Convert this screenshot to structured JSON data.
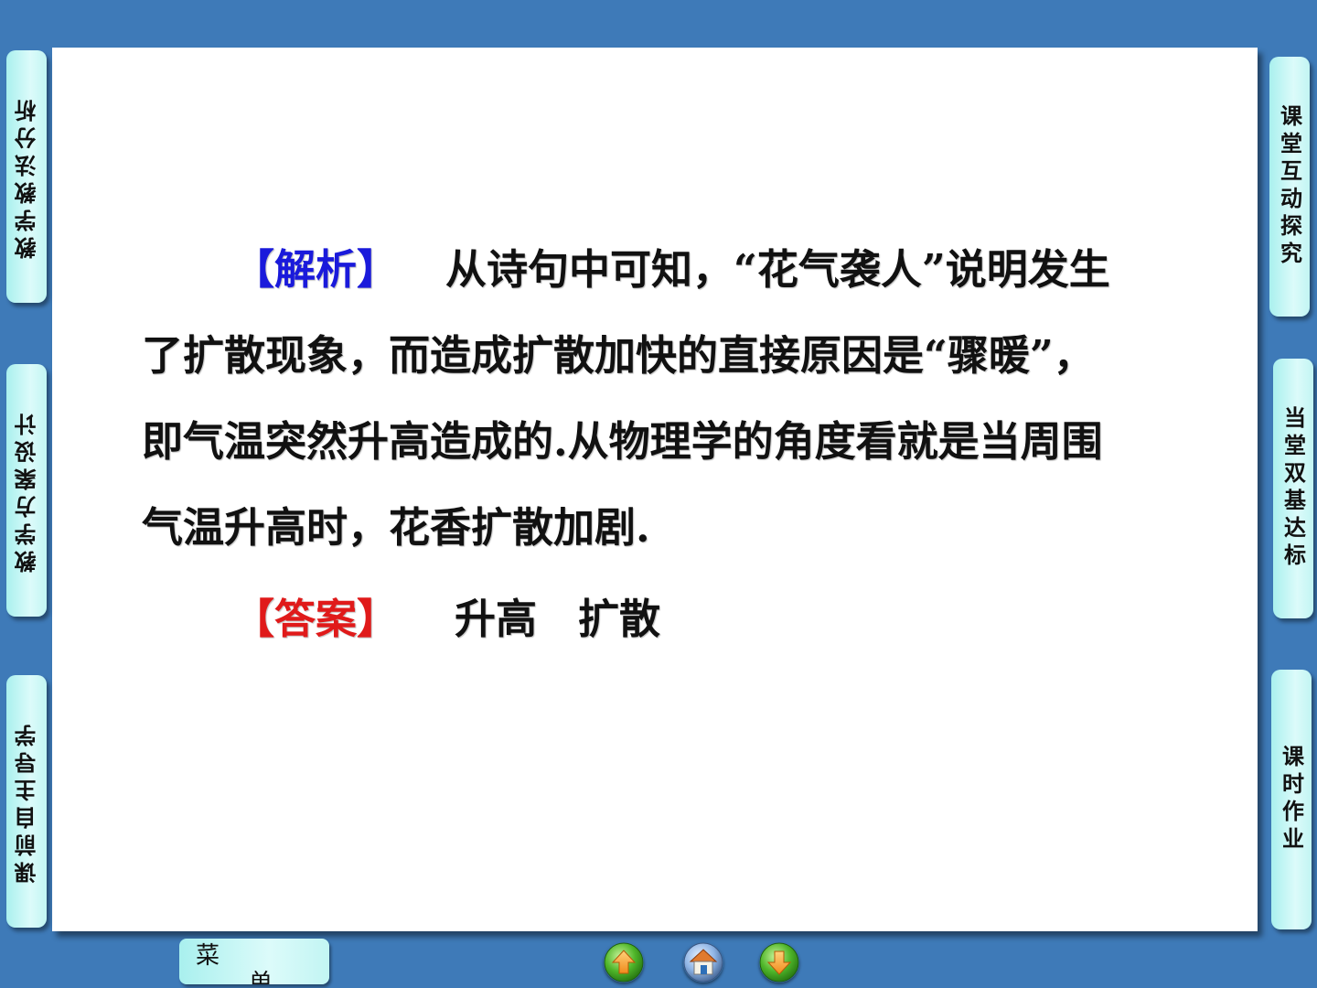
{
  "left_tabs": [
    {
      "label": "教学教法分析"
    },
    {
      "label": "教学方案设计"
    },
    {
      "label": "课前自主导学"
    }
  ],
  "right_tabs": [
    {
      "label": "课堂互动探究"
    },
    {
      "label": "当堂双基达标"
    },
    {
      "label": "课时作业"
    }
  ],
  "content": {
    "analysis_tag": "【解析】",
    "line1": "从诗句中可知，“花气袭人”说明发生",
    "line2": "了扩散现象，而造成扩散加快的直接原因是“骤暖”，",
    "line3": "即气温突然升高造成的.从物理学的角度看就是当周围",
    "line4": "气温升高时，花香扩散加剧.",
    "answer_tag": "【答案】",
    "answer_text": "升高　扩散"
  },
  "bottom_bar": {
    "menu_char1": "菜",
    "menu_char2": "单",
    "nav_icons": [
      "up-arrow-icon",
      "home-icon",
      "down-arrow-icon"
    ]
  },
  "colors": {
    "background": "#3e7ab8",
    "tab": "#c2f5f3",
    "analysis_tag": "#1a1adb",
    "answer_tag": "#e01a1a"
  }
}
